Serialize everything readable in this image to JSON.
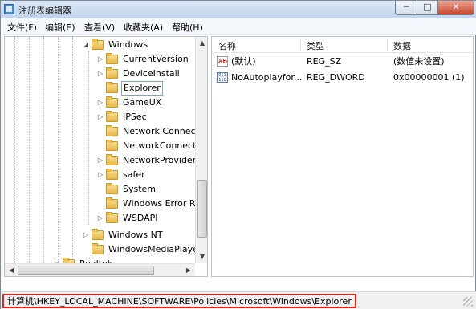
{
  "window": {
    "title": "注册表编辑器",
    "minimize_glyph": "─",
    "maximize_glyph": "□",
    "close_glyph": "✕"
  },
  "menu": {
    "items": [
      {
        "label": "文件(F)"
      },
      {
        "label": "编辑(E)"
      },
      {
        "label": "查看(V)"
      },
      {
        "label": "收藏夹(A)"
      },
      {
        "label": "帮助(H)"
      }
    ]
  },
  "tree": {
    "nodes": [
      {
        "label": "Windows",
        "expander": "◢",
        "selected": false
      },
      {
        "label": "CurrentVersion",
        "expander": "▷",
        "selected": false
      },
      {
        "label": "DeviceInstall",
        "expander": "▷",
        "selected": false
      },
      {
        "label": "Explorer",
        "expander": "",
        "selected": true
      },
      {
        "label": "GameUX",
        "expander": "▷",
        "selected": false
      },
      {
        "label": "IPSec",
        "expander": "▷",
        "selected": false
      },
      {
        "label": "Network Connect",
        "expander": "",
        "selected": false
      },
      {
        "label": "NetworkConnectiv",
        "expander": "",
        "selected": false
      },
      {
        "label": "NetworkProvider",
        "expander": "▷",
        "selected": false
      },
      {
        "label": "safer",
        "expander": "▷",
        "selected": false
      },
      {
        "label": "System",
        "expander": "",
        "selected": false
      },
      {
        "label": "Windows Error Re",
        "expander": "",
        "selected": false
      },
      {
        "label": "WSDAPI",
        "expander": "▷",
        "selected": false
      },
      {
        "label": "Windows NT",
        "expander": "▷",
        "selected": false
      },
      {
        "label": "WindowsMediaPlaye",
        "expander": "",
        "selected": false
      },
      {
        "label": "Realtek",
        "expander": "▷",
        "selected": false
      }
    ]
  },
  "list": {
    "columns": [
      "名称",
      "类型",
      "数据"
    ],
    "rows": [
      {
        "icon": "string-value-icon",
        "icon_glyph": "ab",
        "name": "(默认)",
        "type": "REG_SZ",
        "data": "(数值未设置)"
      },
      {
        "icon": "dword-value-icon",
        "icon_glyph": "011 110",
        "name": "NoAutoplayfor...",
        "type": "REG_DWORD",
        "data": "0x00000001 (1)"
      }
    ]
  },
  "statusbar": {
    "path": "计算机\\HKEY_LOCAL_MACHINE\\SOFTWARE\\Policies\\Microsoft\\Windows\\Explorer"
  }
}
